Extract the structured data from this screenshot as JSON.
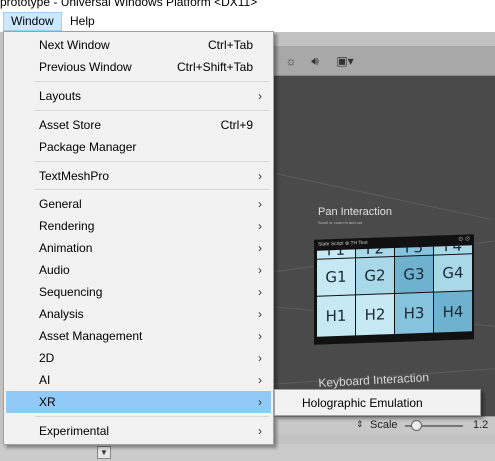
{
  "window_title": "prototype - Universal Windows Platform <DX11>",
  "menubar": {
    "items": [
      "Window",
      "Help"
    ]
  },
  "menu": {
    "items": [
      {
        "label": "Next Window",
        "shortcut": "Ctrl+Tab"
      },
      {
        "label": "Previous Window",
        "shortcut": "Ctrl+Shift+Tab"
      },
      {
        "label": "Layouts",
        "arrow": "›"
      },
      {
        "label": "Asset Store",
        "shortcut": "Ctrl+9"
      },
      {
        "label": "Package Manager"
      },
      {
        "label": "TextMeshPro",
        "arrow": "›"
      },
      {
        "label": "General",
        "arrow": "›"
      },
      {
        "label": "Rendering",
        "arrow": "›"
      },
      {
        "label": "Animation",
        "arrow": "›"
      },
      {
        "label": "Audio",
        "arrow": "›"
      },
      {
        "label": "Sequencing",
        "arrow": "›"
      },
      {
        "label": "Analysis",
        "arrow": "›"
      },
      {
        "label": "Asset Management",
        "arrow": "›"
      },
      {
        "label": "2D",
        "arrow": "›"
      },
      {
        "label": "AI",
        "arrow": "›"
      },
      {
        "label": "XR",
        "arrow": "›",
        "highlighted": true
      },
      {
        "label": "Experimental",
        "arrow": "›"
      }
    ]
  },
  "submenu": {
    "items": [
      {
        "label": "Holographic Emulation"
      }
    ]
  },
  "scene": {
    "pan_label": "Pan Interaction",
    "pan_sub": "Scroll or zoom in and out",
    "keyboard_label": "Keyboard Interaction",
    "panel_title": "Slate Script  ⊕  TH  Text",
    "panel_icons": "⊙ ⊙",
    "grid_cells": [
      [
        "F1",
        "F2",
        "F3",
        "F4"
      ],
      [
        "G1",
        "G2",
        "G3",
        "G4"
      ],
      [
        "H1",
        "H2",
        "H3",
        "H4"
      ]
    ],
    "cell_colors": [
      "#c7e9f3",
      "#a9d8e9",
      "#86c3dc",
      "#6fb2cf"
    ]
  },
  "toolbar": {
    "icons": [
      "sun-icon",
      "sound-icon",
      "image-icon"
    ],
    "image_dropdown_arrow": "▾"
  },
  "scalebar": {
    "arrow": "⇕",
    "label": "Scale",
    "value": "1.2"
  },
  "bottom": {
    "dropdown_arrow": "▼"
  }
}
